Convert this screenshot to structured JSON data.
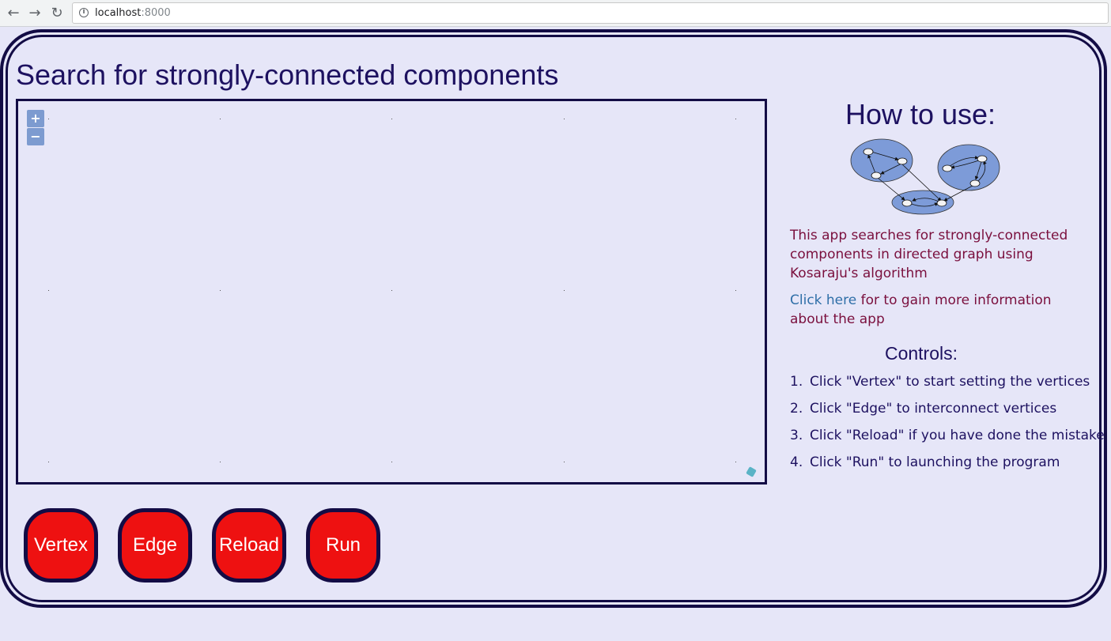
{
  "browser": {
    "url_host": "localhost",
    "url_port": ":8000",
    "back_glyph": "←",
    "forward_glyph": "→",
    "reload_glyph": "↻",
    "info_glyph": "i"
  },
  "page": {
    "title": "Search for strongly-connected components"
  },
  "map": {
    "zoom_in": "+",
    "zoom_out": "−"
  },
  "buttons": {
    "vertex": "Vertex",
    "edge": "Edge",
    "reload": "Reload",
    "run": "Run"
  },
  "help": {
    "title": "How to use:",
    "description": "This app searches for strongly-connected components in directed graph using Kosaraju's algorithm",
    "link_text": "Click here",
    "link_suffix": " for to gain more information about the app",
    "controls_title": "Controls:",
    "controls": [
      {
        "num": "1.",
        "text": "Click \"Vertex\" to start setting the vertices"
      },
      {
        "num": "2.",
        "text": "Click \"Edge\" to interconnect vertices"
      },
      {
        "num": "3.",
        "text": "Click \"Reload\" if you have done the mistake"
      },
      {
        "num": "4.",
        "text": "Click \"Run\" to launching the program"
      }
    ]
  },
  "colors": {
    "background": "#e6e6f8",
    "frame": "#130c45",
    "title": "#1d1160",
    "button": "#ee1111",
    "description": "#7a0f3d",
    "link": "#2f6fa8",
    "diagram_fill": "#7d9bd8"
  },
  "icons": {
    "back": "arrow-left-icon",
    "forward": "arrow-right-icon",
    "reload": "reload-icon",
    "info": "info-icon",
    "attribution": "attribution-icon"
  }
}
